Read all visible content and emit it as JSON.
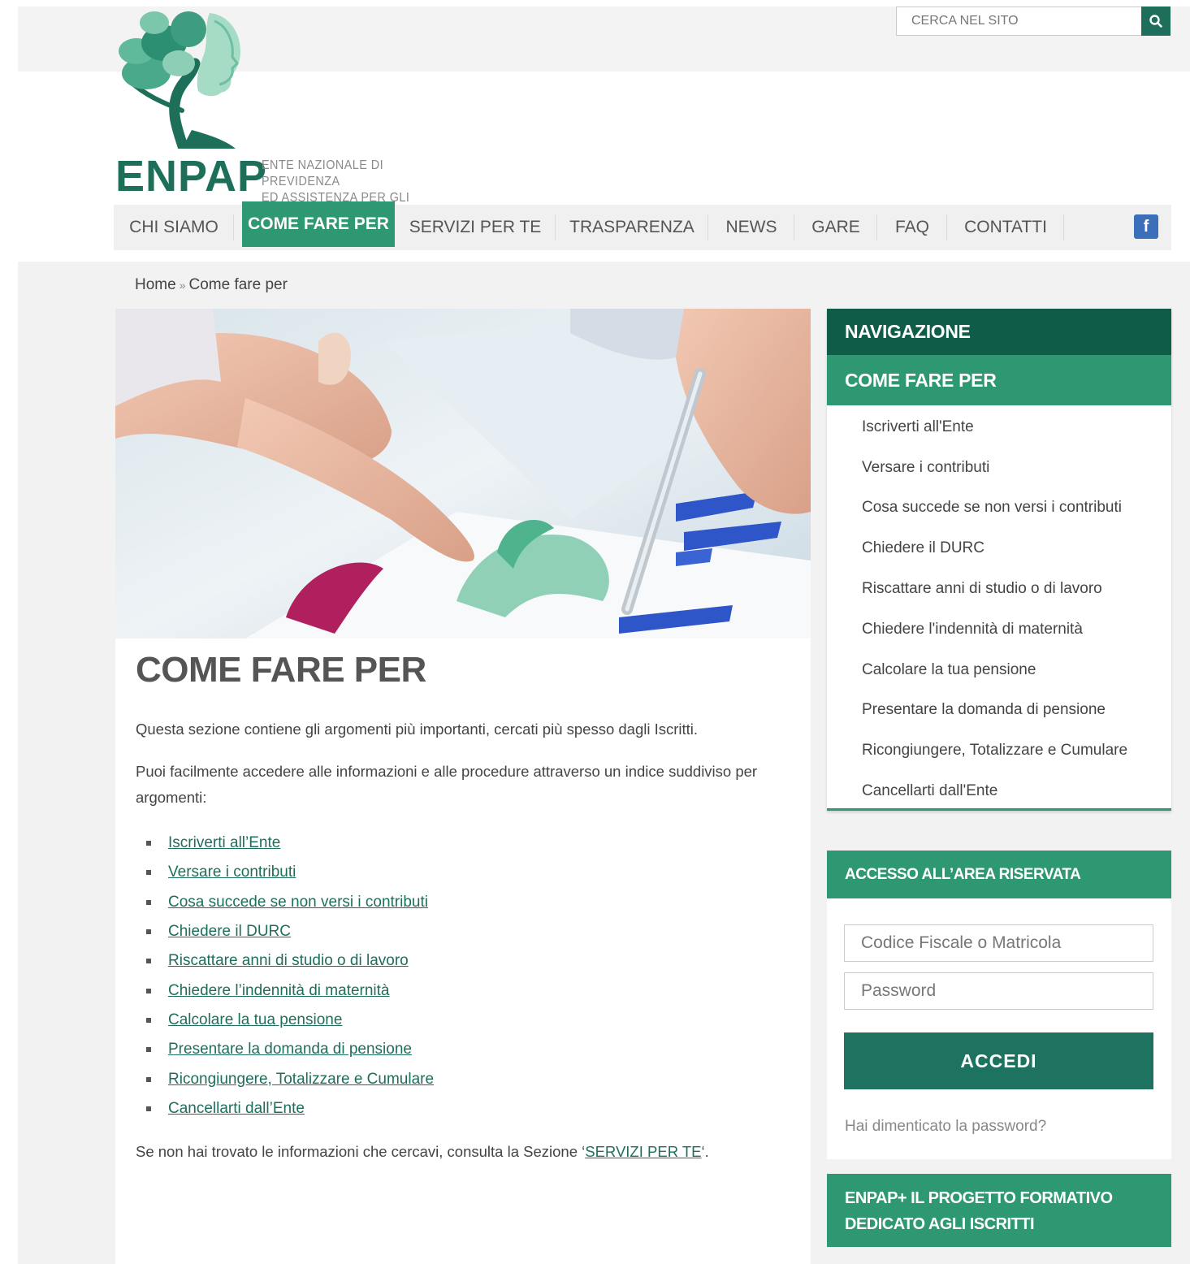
{
  "search": {
    "placeholder": "CERCA NEL SITO",
    "icon": "search-icon"
  },
  "logo": {
    "wordmark": "ENPAP",
    "tagline_line1": "ENTE NAZIONALE DI PREVIDENZA",
    "tagline_line2": "ED ASSISTENZA PER GLI PSICOLOGI"
  },
  "nav": {
    "items": [
      {
        "label": "CHI SIAMO"
      },
      {
        "label": "COME FARE PER"
      },
      {
        "label": "SERVIZI PER TE"
      },
      {
        "label": "TRASPARENZA"
      },
      {
        "label": "NEWS"
      },
      {
        "label": "GARE"
      },
      {
        "label": "FAQ"
      },
      {
        "label": "CONTATTI"
      }
    ],
    "active": "COME FARE PER",
    "social_icon": "facebook-icon",
    "social_glyph": "f"
  },
  "breadcrumb": {
    "home": "Home",
    "separator": "»",
    "current": "Come fare per"
  },
  "main": {
    "title": "COME FARE PER",
    "intro": "Questa sezione contiene gli argomenti più importanti, cercati più spesso dagli Iscritti.",
    "intro2": "Puoi facilmente accedere alle informazioni e alle procedure attraverso un indice suddiviso per argomenti:",
    "links": [
      "Iscriverti all’Ente",
      "Versare i contributi",
      "Cosa succede se non versi i contributi",
      "Chiedere il DURC",
      "Riscattare anni di studio o di lavoro",
      "Chiedere l’indennità di maternità",
      "Calcolare la tua pensione",
      "Presentare la domanda di pensione",
      "Ricongiungere, Totalizzare e Cumulare",
      "Cancellarti dall’Ente"
    ],
    "footer_before": "Se non hai trovato le informazioni che cercavi, consulta la Sezione ‘",
    "footer_link": "SERVIZI PER TE",
    "footer_after": "‘."
  },
  "sidebar": {
    "heading": "NAVIGAZIONE",
    "section": "COME FARE PER",
    "items": [
      "Iscriverti all'Ente",
      "Versare i contributi",
      "Cosa succede se non versi i contributi",
      "Chiedere il DURC",
      "Riscattare anni di studio o di lavoro",
      "Chiedere l'indennità di maternità",
      "Calcolare la tua pensione",
      "Presentare la domanda di pensione",
      "Ricongiungere, Totalizzare e Cumulare",
      "Cancellarti dall'Ente"
    ]
  },
  "login": {
    "heading": "ACCESSO ALL’AREA RISERVATA",
    "user_placeholder": "Codice Fiscale o Matricola",
    "password_placeholder": "Password",
    "button": "ACCEDI",
    "forgot": "Hai dimenticato la password?"
  },
  "promo": {
    "title": "ENPAP+ IL PROGETTO FORMATIVO DEDICATO AGLI ISCRITTI"
  },
  "colors": {
    "brand_dark": "#0f5c49",
    "brand": "#2e9873",
    "button": "#1e7260",
    "link": "#1e6e5c",
    "facebook": "#3b6fba"
  }
}
